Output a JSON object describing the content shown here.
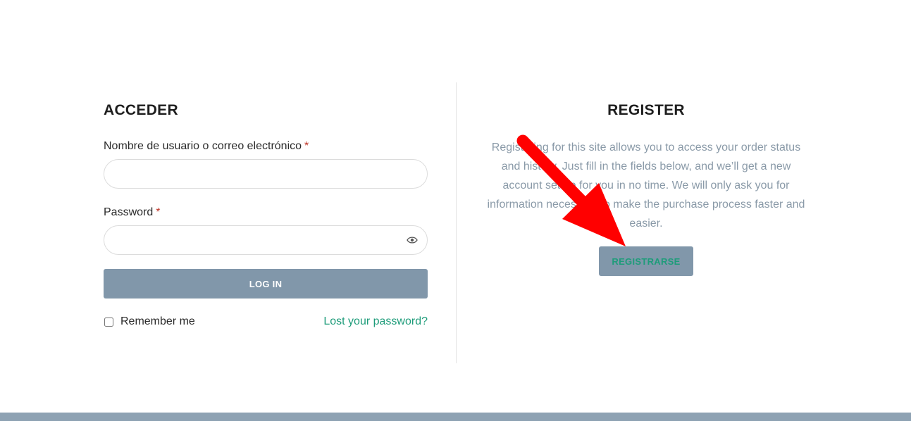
{
  "login": {
    "title": "ACCEDER",
    "username_label": "Nombre de usuario o correo electrónico",
    "required_mark": "*",
    "username_value": "",
    "password_label": "Password",
    "password_value": "",
    "login_button": "LOG IN",
    "remember_label": "Remember me",
    "remember_checked": false,
    "lost_password": "Lost your password?"
  },
  "register": {
    "title": "REGISTER",
    "description": "Registering for this site allows you to access your order status and history. Just fill in the fields below, and we’ll get a new account set up for you in no time. We will only ask you for information necessary to make the purchase process faster and easier.",
    "button": "REGISTRARSE"
  },
  "icons": {
    "password_toggle": "eye-icon",
    "annotation": "red-arrow-icon"
  },
  "colors": {
    "accent_link": "#1e9c7a",
    "button_bg": "#8197aa",
    "annotation_arrow": "#ff0000"
  }
}
